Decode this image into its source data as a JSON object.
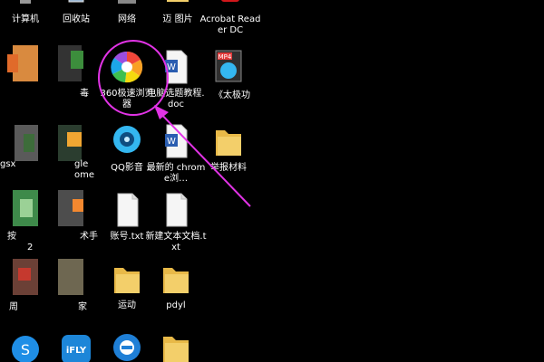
{
  "desktop": {
    "row_top": [
      {
        "label": "计算机"
      },
      {
        "label": "回收站"
      },
      {
        "label": "网络"
      },
      {
        "label": "迈  图片"
      },
      {
        "label": "Acrobat Reader DC"
      }
    ],
    "icons": {
      "browser360": {
        "label": "360极速浏览器"
      },
      "doc1": {
        "label": "电脑选题教程.doc"
      },
      "mp4": {
        "label": "《太极功"
      },
      "qq_player": {
        "label": "QQ影音"
      },
      "chrome_shortcut": {
        "label": "最新的 chrome浏…"
      },
      "folder_apply": {
        "label": "举报材料"
      },
      "txt_account": {
        "label": "账号.txt"
      },
      "txt_new": {
        "label": "新建文本文档.txt"
      },
      "folder_sport": {
        "label": "运动"
      },
      "folder_pdyl": {
        "label": "pdyl"
      },
      "partial_gle": {
        "label": "gle"
      },
      "partial_ome": {
        "label": "ome"
      },
      "partial_gsx": {
        "label": "gsx"
      },
      "partial_shu": {
        "label": "术手"
      },
      "partial_jia": {
        "label": "家"
      },
      "partial_ke": {
        "label": "按"
      },
      "partial_zhou": {
        "label": "周"
      },
      "partial_du": {
        "label": "毒"
      },
      "partial_2": {
        "label": "2"
      },
      "ifly": {
        "label": "iFLY"
      }
    }
  },
  "colors": {
    "annotation": "#e233e6",
    "folder": "#f3cf6a",
    "ie_blue": "#1f7fd6"
  }
}
